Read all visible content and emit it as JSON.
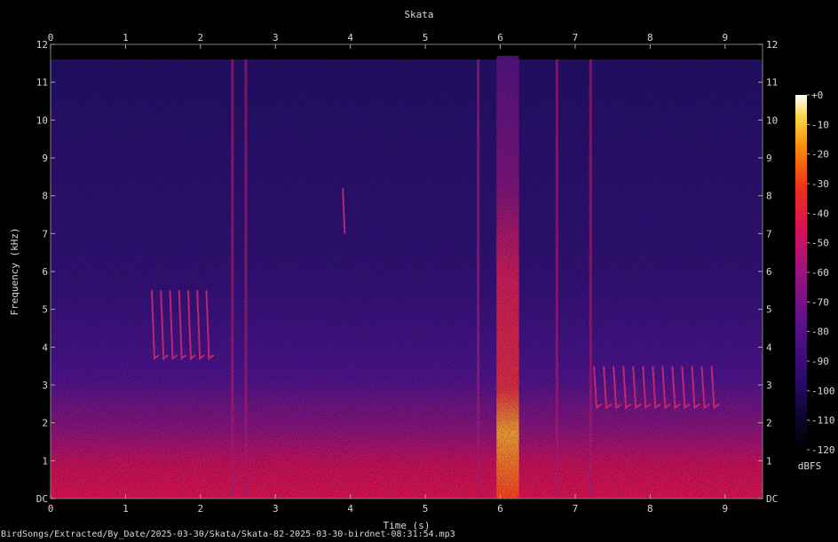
{
  "chart_data": {
    "type": "heatmap",
    "title": "Skata",
    "xlabel": "Time (s)",
    "ylabel": "Frequency (kHz)",
    "xlim": [
      0,
      9.5
    ],
    "ylim": [
      0,
      12
    ],
    "x_ticks": [
      "0",
      "1",
      "2",
      "3",
      "4",
      "5",
      "6",
      "7",
      "8",
      "9"
    ],
    "y_ticks": [
      "DC",
      "1",
      "2",
      "3",
      "4",
      "5",
      "6",
      "7",
      "8",
      "9",
      "10",
      "11",
      "12"
    ],
    "colorbar": {
      "label": "dBFS",
      "ticks": [
        "+0",
        "-10",
        "-20",
        "-30",
        "-40",
        "-50",
        "-60",
        "-70",
        "-80",
        "-90",
        "-100",
        "-110",
        "-120"
      ],
      "range": [
        -120,
        0
      ]
    },
    "features": [
      {
        "kind": "click",
        "t": 2.42
      },
      {
        "kind": "click",
        "t": 2.6
      },
      {
        "kind": "click",
        "t": 5.7
      },
      {
        "kind": "click",
        "t": 6.75
      },
      {
        "kind": "click",
        "t": 7.2
      },
      {
        "kind": "broadband-burst",
        "t_start": 5.95,
        "t_end": 6.25,
        "f_max_khz": 11.7
      },
      {
        "kind": "call",
        "t_start": 1.35,
        "t_end": 2.2,
        "f_low_khz": 3.7,
        "f_high_khz": 5.5
      },
      {
        "kind": "call",
        "t_start": 7.25,
        "t_end": 8.95,
        "f_low_khz": 2.4,
        "f_high_khz": 3.5
      },
      {
        "kind": "chirp",
        "t": 3.9,
        "f_low_khz": 7.0,
        "f_high_khz": 8.2
      }
    ]
  },
  "file_path": "BirdSongs/Extracted/By_Date/2025-03-30/Skata/Skata-82-2025-03-30-birdnet-08:31:54.mp3"
}
